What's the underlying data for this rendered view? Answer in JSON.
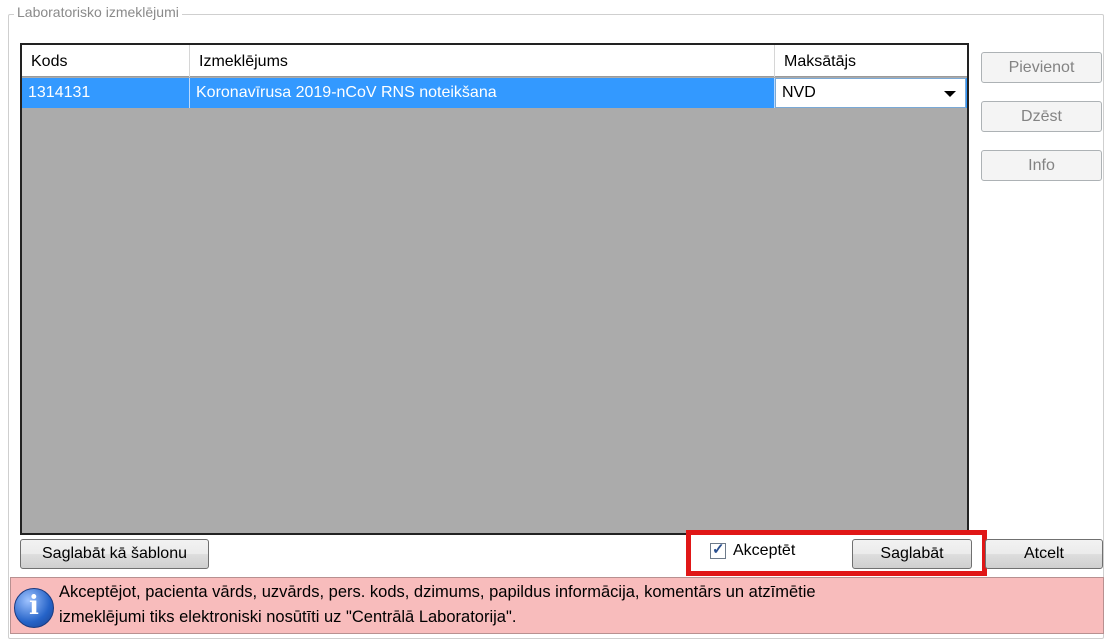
{
  "group": {
    "title": "Laboratorisko izmeklējumi"
  },
  "grid": {
    "columns": [
      "Kods",
      "Izmeklējums",
      "Maksātājs"
    ],
    "rows": [
      {
        "code": "1314131",
        "name": "Koronavīrusa 2019-nCoV RNS noteikšana",
        "payer": "NVD",
        "selected": true
      }
    ]
  },
  "side_buttons": {
    "add": "Pievienot",
    "delete": "Dzēst",
    "info": "Info"
  },
  "bottom": {
    "save_template": "Saglabāt kā šablonu",
    "accept_label": "Akceptēt",
    "accept_checked": true,
    "save": "Saglabāt",
    "cancel": "Atcelt"
  },
  "info": {
    "line1": "Akceptējot, pacienta vārds, uzvārds, pers. kods, dzimums, papildus informācija, komentārs un atzīmētie",
    "line2": "izmeklējumi tiks elektroniski nosūtīti uz \"Centrālā Laboratorija\"."
  },
  "colors": {
    "selection": "#3399ff",
    "grid_empty": "#ababab",
    "info_bg": "#f8bcbc",
    "highlight": "#e01717"
  },
  "icons": {
    "info": "info-icon",
    "dropdown": "chevron-down-icon",
    "check": "checkmark-icon"
  }
}
